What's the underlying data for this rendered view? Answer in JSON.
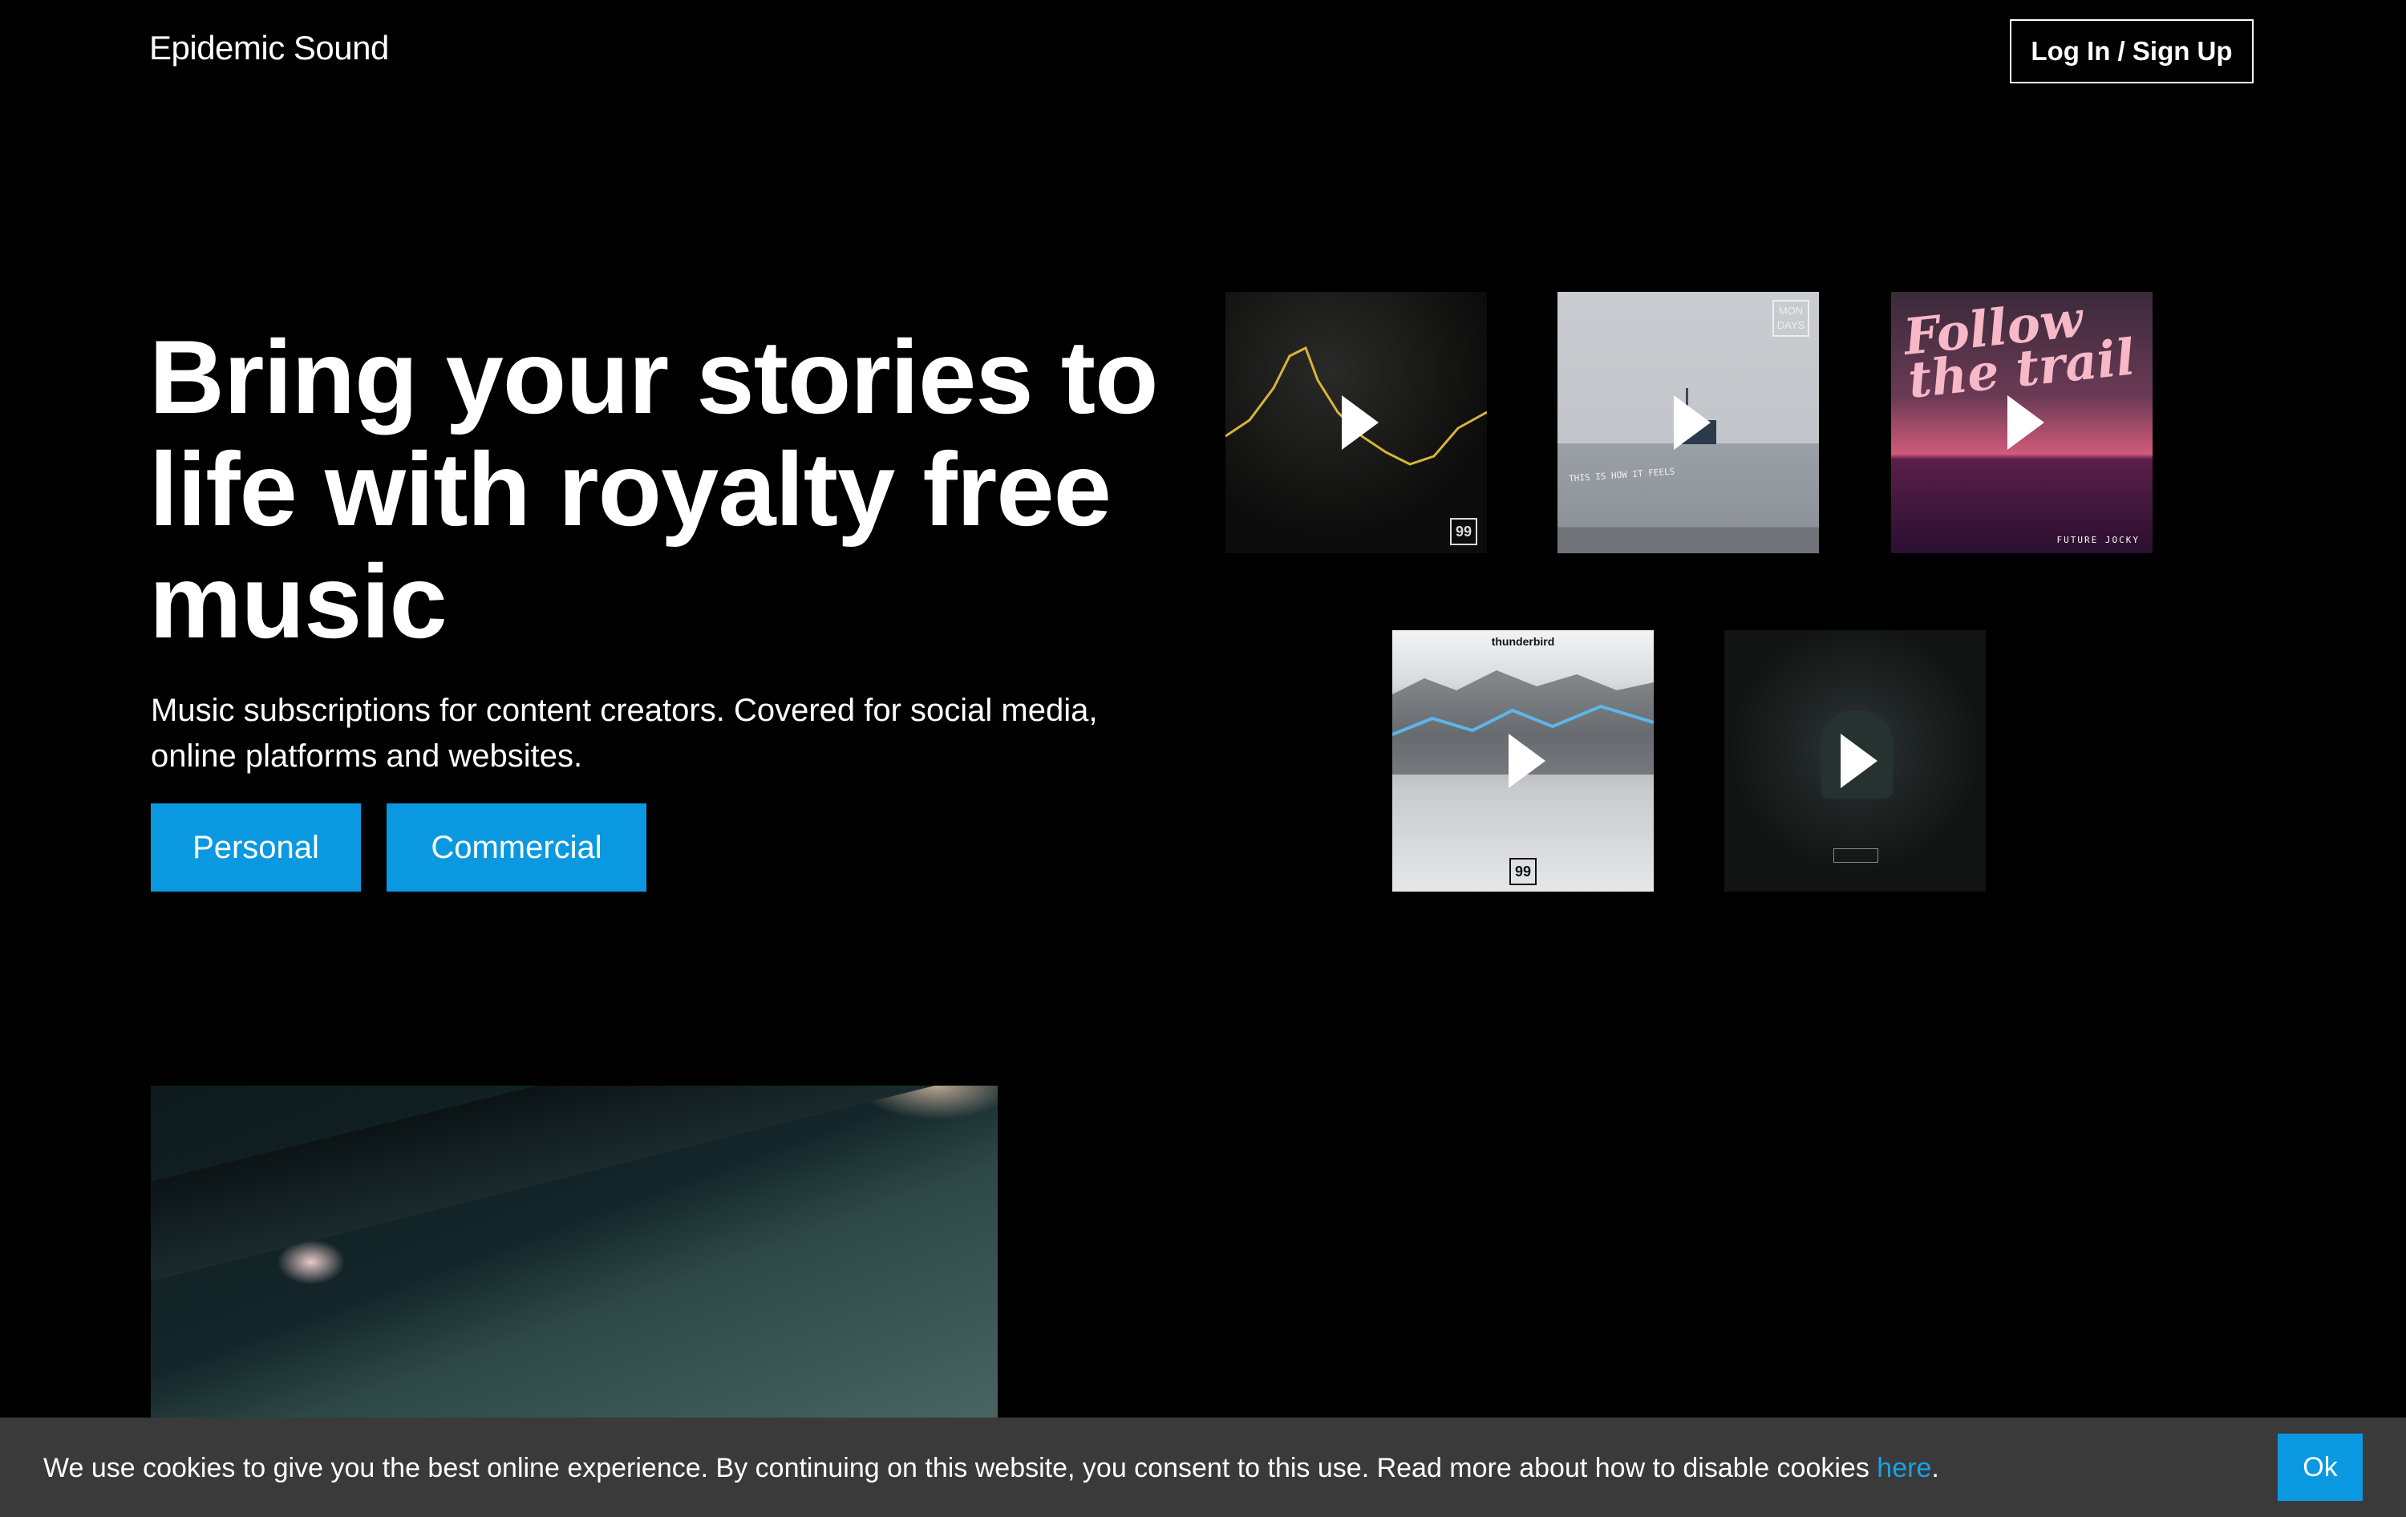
{
  "header": {
    "logo": "Epidemic Sound",
    "login_label": "Log In / Sign Up"
  },
  "hero": {
    "title": "Bring your stories to life with royalty free music",
    "subtitle": "Music subscriptions for content creators. Covered for social media, online platforms and websites.",
    "personal_label": "Personal",
    "commercial_label": "Commercial"
  },
  "albums": [
    {
      "icon": "play-icon",
      "badge": "99"
    },
    {
      "icon": "play-icon",
      "badge": "MON DAYS",
      "caption": "THIS IS HOW IT FEELS"
    },
    {
      "icon": "play-icon",
      "art_title": "Follow the trail",
      "artist": "FUTURE JOCKY"
    },
    {
      "icon": "play-icon",
      "tag": "thunderbird",
      "badge": "99"
    },
    {
      "icon": "play-icon"
    }
  ],
  "cookie": {
    "text": "We use cookies to give you the best online experience. By continuing on this website, you consent to this use. Read more about how to disable cookies ",
    "link_label": "here",
    "period": ".",
    "ok_label": "Ok"
  },
  "colors": {
    "background": "#000000",
    "accent": "#0a99e0",
    "link": "#19a3e6",
    "cookie_bar": "#3a3a3a"
  }
}
